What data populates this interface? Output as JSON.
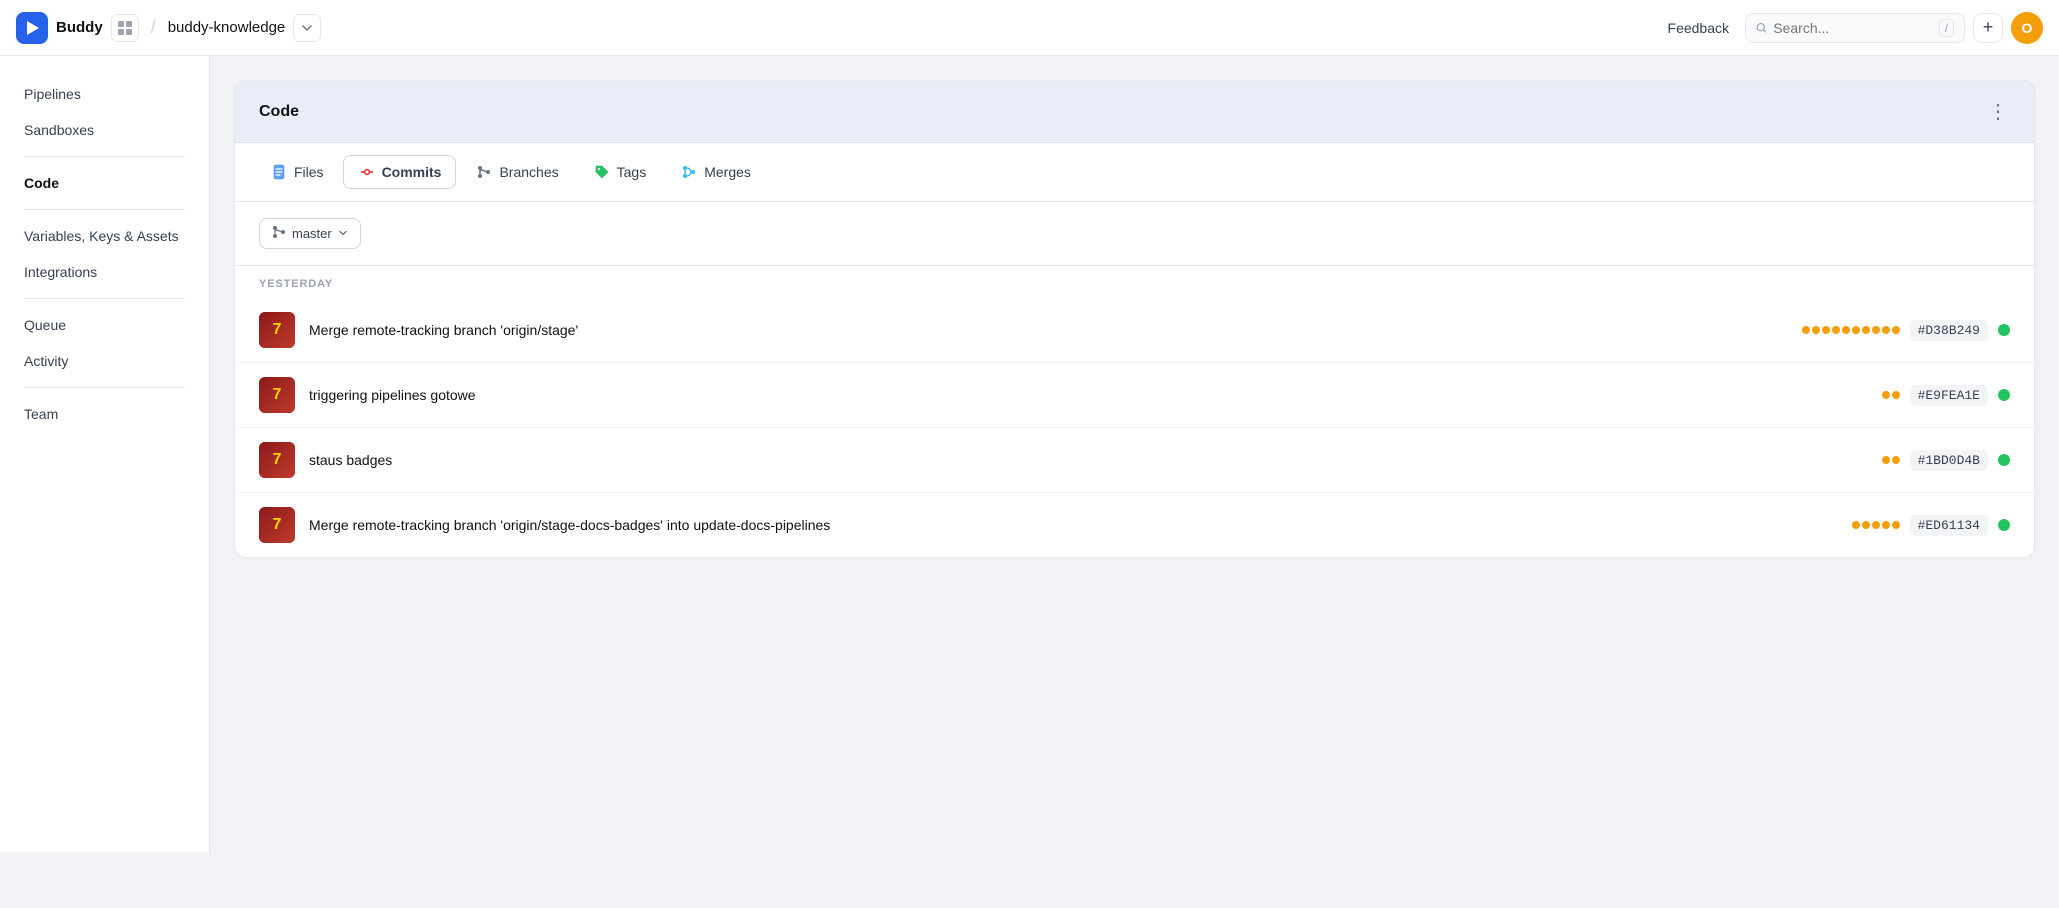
{
  "header": {
    "logo_letter": "▶",
    "app_name": "Buddy",
    "project_name": "buddy-knowledge",
    "feedback_label": "Feedback",
    "search_placeholder": "Search...",
    "slash_shortcut": "/",
    "plus_label": "+",
    "avatar_letter": "O"
  },
  "sidebar": {
    "items": [
      {
        "label": "Pipelines",
        "active": false
      },
      {
        "label": "Sandboxes",
        "active": false
      },
      {
        "label": "Code",
        "active": true
      },
      {
        "label": "Variables, Keys & Assets",
        "active": false
      },
      {
        "label": "Integrations",
        "active": false
      },
      {
        "label": "Queue",
        "active": false
      },
      {
        "label": "Activity",
        "active": false
      },
      {
        "label": "Team",
        "active": false
      }
    ]
  },
  "card": {
    "title": "Code",
    "menu_icon": "⋮"
  },
  "tabs": [
    {
      "label": "Files",
      "icon": "files",
      "active": false
    },
    {
      "label": "Commits",
      "icon": "commits",
      "active": true
    },
    {
      "label": "Branches",
      "icon": "branches",
      "active": false
    },
    {
      "label": "Tags",
      "icon": "tags",
      "active": false
    },
    {
      "label": "Merges",
      "icon": "merges",
      "active": false
    }
  ],
  "branch": {
    "name": "master",
    "dropdown_icon": "⌄"
  },
  "commits": {
    "section_label": "YESTERDAY",
    "items": [
      {
        "message": "Merge remote-tracking branch 'origin/stage'",
        "hash": "#D38B249",
        "dots_count": 10,
        "status": "green"
      },
      {
        "message": "triggering pipelines gotowe",
        "hash": "#E9FEA1E",
        "dots_count": 2,
        "status": "green"
      },
      {
        "message": "staus badges",
        "hash": "#1BD0D4B",
        "dots_count": 2,
        "status": "green"
      },
      {
        "message": "Merge remote-tracking branch 'origin/stage-docs-badges' into update-docs-pipelines",
        "hash": "#ED61134",
        "dots_count": 5,
        "status": "green"
      }
    ]
  }
}
